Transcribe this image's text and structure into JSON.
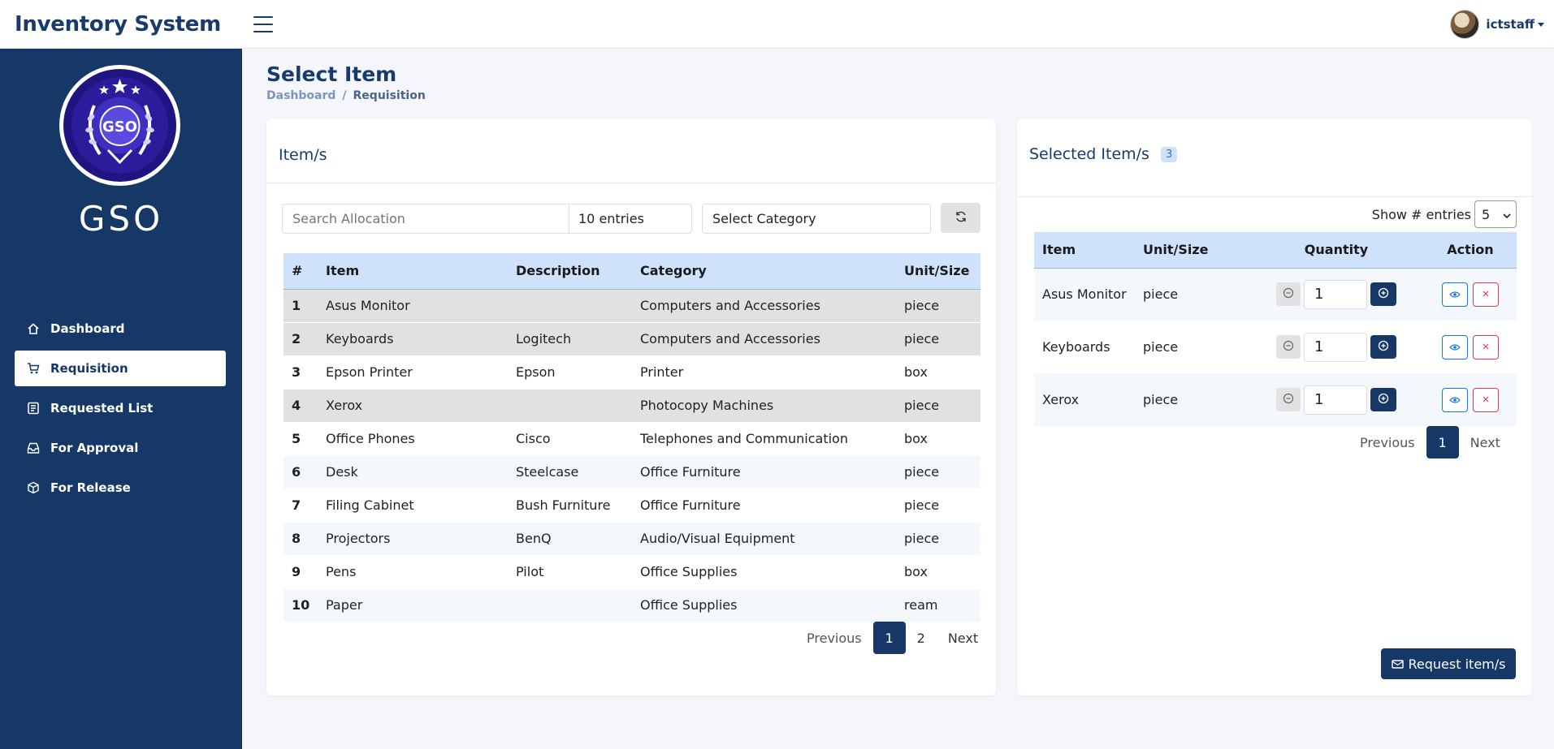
{
  "app": {
    "brand": "Inventory System",
    "username": "ictstaff"
  },
  "sidebar": {
    "title": "GSO",
    "logo_text": "GSO",
    "items": [
      {
        "label": "Dashboard",
        "icon": "home-icon"
      },
      {
        "label": "Requisition",
        "icon": "cart-icon"
      },
      {
        "label": "Requested List",
        "icon": "list-icon"
      },
      {
        "label": "For Approval",
        "icon": "inbox-icon"
      },
      {
        "label": "For Release",
        "icon": "box-icon"
      }
    ],
    "active": "Requisition"
  },
  "page": {
    "title": "Select Item",
    "breadcrumb": [
      "Dashboard",
      "Requisition"
    ]
  },
  "items_card": {
    "title": "Item/s",
    "search_placeholder": "Search Allocation",
    "entries_value": "10 entries",
    "category_value": "Select Category",
    "columns": [
      "#",
      "Item",
      "Description",
      "Category",
      "Unit/Size"
    ],
    "rows": [
      {
        "num": "1",
        "item": "Asus Monitor",
        "description": "",
        "category": "Computers and Accessories",
        "unit": "piece"
      },
      {
        "num": "2",
        "item": "Keyboards",
        "description": "Logitech",
        "category": "Computers and Accessories",
        "unit": "piece"
      },
      {
        "num": "3",
        "item": "Epson Printer",
        "description": "Epson",
        "category": "Printer",
        "unit": "box"
      },
      {
        "num": "4",
        "item": "Xerox",
        "description": "",
        "category": "Photocopy Machines",
        "unit": "piece"
      },
      {
        "num": "5",
        "item": "Office Phones",
        "description": "Cisco",
        "category": "Telephones and Communication",
        "unit": "box"
      },
      {
        "num": "6",
        "item": "Desk",
        "description": "Steelcase",
        "category": "Office Furniture",
        "unit": "piece"
      },
      {
        "num": "7",
        "item": "Filing Cabinet",
        "description": "Bush Furniture",
        "category": "Office Furniture",
        "unit": "piece"
      },
      {
        "num": "8",
        "item": "Projectors",
        "description": "BenQ",
        "category": "Audio/Visual Equipment",
        "unit": "piece"
      },
      {
        "num": "9",
        "item": "Pens",
        "description": "Pilot",
        "category": "Office Supplies",
        "unit": "box"
      },
      {
        "num": "10",
        "item": "Paper",
        "description": "",
        "category": "Office Supplies",
        "unit": "ream"
      }
    ],
    "pager": {
      "previous": "Previous",
      "pages": [
        "1",
        "2"
      ],
      "current": "1",
      "next": "Next"
    }
  },
  "selected_card": {
    "title": "Selected Item/s",
    "count": "3",
    "show_entries_label": "Show # entries",
    "show_entries_value": "5",
    "columns": [
      "Item",
      "Unit/Size",
      "Quantity",
      "Action"
    ],
    "rows": [
      {
        "item": "Asus Monitor",
        "unit": "piece",
        "qty": "1"
      },
      {
        "item": "Keyboards",
        "unit": "piece",
        "qty": "1"
      },
      {
        "item": "Xerox",
        "unit": "piece",
        "qty": "1"
      }
    ],
    "pager": {
      "previous": "Previous",
      "current": "1",
      "next": "Next"
    },
    "request_button": "Request item/s"
  },
  "colors": {
    "primary": "#163866",
    "header_row": "#cfe2fb",
    "danger": "#e0394b",
    "info": "#1a73e8"
  }
}
